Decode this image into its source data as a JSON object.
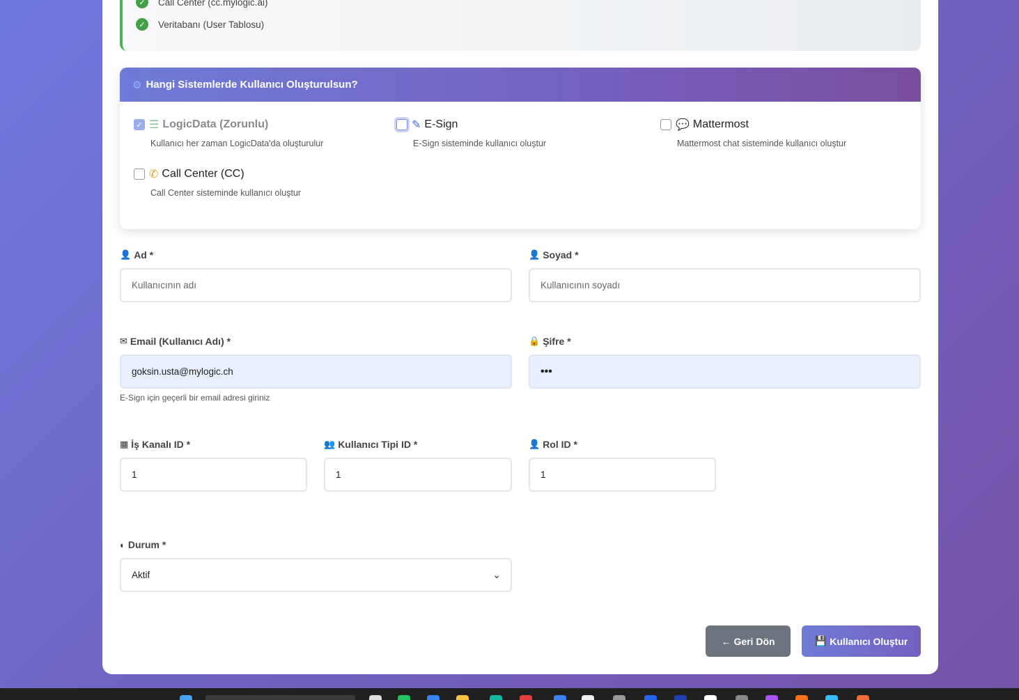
{
  "verified": {
    "items": [
      "Call Center (cc.mylogic.ai)",
      "Veritabanı (User Tablosu)"
    ]
  },
  "systems": {
    "title": "Hangi Sistemlerde Kullanıcı Oluşturulsun?",
    "options": [
      {
        "label": "LogicData (Zorunlu)",
        "desc": "Kullanıcı her zaman LogicData'da oluşturulur",
        "checked": true
      },
      {
        "label": "E-Sign",
        "desc": "E-Sign sisteminde kullanıcı oluştur",
        "checked": false
      },
      {
        "label": "Mattermost",
        "desc": "Mattermost chat sisteminde kullanıcı oluştur",
        "checked": false
      },
      {
        "label": "Call Center (CC)",
        "desc": "Call Center sisteminde kullanıcı oluştur",
        "checked": false
      }
    ]
  },
  "form": {
    "ad_label": "Ad *",
    "ad_placeholder": "Kullanıcının adı",
    "soyad_label": "Soyad *",
    "soyad_placeholder": "Kullanıcının soyadı",
    "email_label": "Email (Kullanıcı Adı) *",
    "email_value": "goksin.usta@mylogic.ch",
    "email_hint": "E-Sign için geçerli bir email adresi giriniz",
    "sifre_label": "Şifre *",
    "sifre_value": "•••",
    "is_kanali_label": "İş Kanalı ID *",
    "is_kanali_value": "1",
    "kullanici_tipi_label": "Kullanıcı Tipi ID *",
    "kullanici_tipi_value": "1",
    "rol_label": "Rol ID *",
    "rol_value": "1",
    "durum_label": "Durum *",
    "durum_value": "Aktif"
  },
  "buttons": {
    "back": "Geri Dön",
    "create": "Kullanıcı Oluştur"
  },
  "colors": {
    "accent": "#6f7bd8",
    "success": "#43a047",
    "secondary": "#6c757d"
  }
}
